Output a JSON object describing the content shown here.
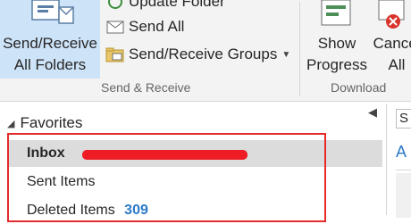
{
  "ribbon": {
    "send_receive_all": "Send/Receive\nAll Folders",
    "update_folder": "Update Folder",
    "send_all": "Send All",
    "send_receive_groups": "Send/Receive Groups",
    "group_send_receive": "Send & Receive",
    "show_progress": "Show\nProgress",
    "cancel_all": "Cancel\nAll",
    "group_download": "Download"
  },
  "folder_pane": {
    "favorites_label": "Favorites",
    "items": [
      {
        "label": "Inbox",
        "count": "",
        "selected": true
      },
      {
        "label": "Sent Items",
        "count": "",
        "selected": false
      },
      {
        "label": "Deleted Items",
        "count": "309",
        "selected": false
      }
    ]
  },
  "right_pane": {
    "search_fragment": "S",
    "header_fragment": "A"
  },
  "colors": {
    "accent": "#2b79c8",
    "selected_button": "#cde3f7",
    "annotation_red": "#e52b2b"
  }
}
